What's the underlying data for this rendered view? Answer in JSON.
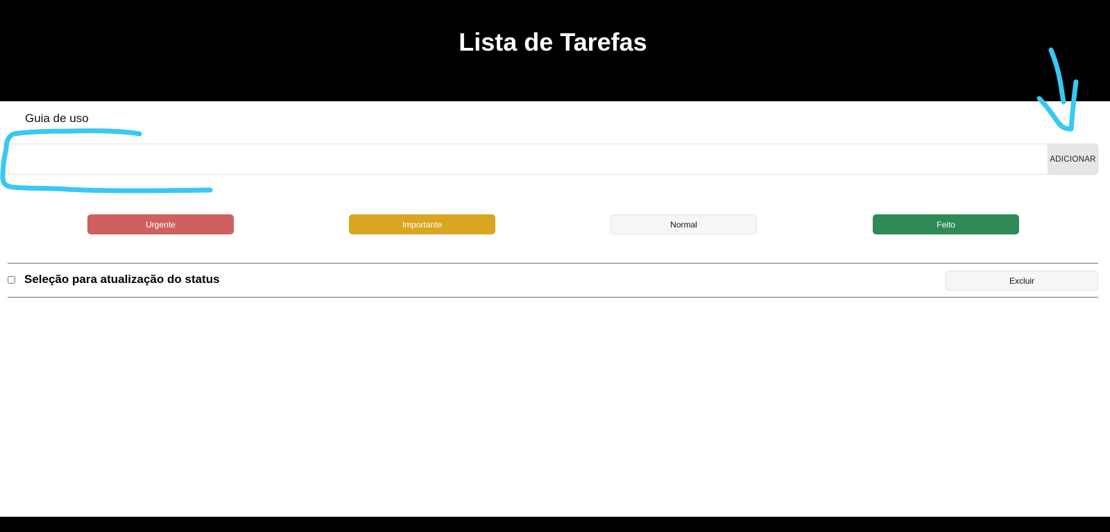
{
  "header": {
    "title": "Lista de Tarefas",
    "background": "#000000"
  },
  "guide": {
    "label": "Guia de uso"
  },
  "task_form": {
    "input_value": "",
    "add_label": "ADICIONAR"
  },
  "priority_buttons": [
    {
      "label": "Urgente",
      "color": "#d06060",
      "text_color": "#ffffff"
    },
    {
      "label": "Importante",
      "color": "#daa520",
      "text_color": "#ffffff"
    },
    {
      "label": "Normal",
      "color": "#f6f6f6",
      "text_color": "#111111"
    },
    {
      "label": "Feito",
      "color": "#2e8b57",
      "text_color": "#ffffff"
    }
  ],
  "task_list": {
    "select_all_checked": false,
    "status_label": "Seleção para atualização do status",
    "delete_label": "Excluir"
  },
  "annotation_color": "#38c8f4"
}
